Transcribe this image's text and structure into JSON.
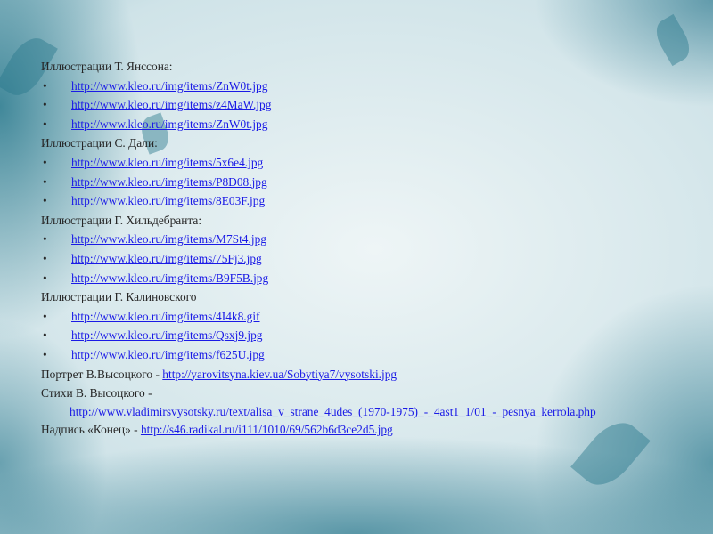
{
  "sections": [
    {
      "heading": "Иллюстрации Т. Янссона:",
      "links": [
        "http://www.kleo.ru/img/items/ZnW0t.jpg",
        "http://www.kleo.ru/img/items/z4MaW.jpg",
        "http://www.kleo.ru/img/items/ZnW0t.jpg"
      ]
    },
    {
      "heading": "Иллюстрации С. Дали:",
      "links": [
        "http://www.kleo.ru/img/items/5x6e4.jpg",
        "http://www.kleo.ru/img/items/P8D08.jpg",
        "http://www.kleo.ru/img/items/8E03F.jpg"
      ]
    },
    {
      "heading": "Иллюстрации  Г. Хильдебранта:",
      "links": [
        "http://www.kleo.ru/img/items/M7St4.jpg",
        "http://www.kleo.ru/img/items/75Fj3.jpg",
        "http://www.kleo.ru/img/items/B9F5B.jpg"
      ]
    },
    {
      "heading": "Иллюстрации  Г. Калиновского",
      "links": [
        "http://www.kleo.ru/img/items/4I4k8.gif",
        "http://www.kleo.ru/img/items/Qsxj9.jpg",
        "http://www.kleo.ru/img/items/f625U.jpg"
      ]
    }
  ],
  "portrait": {
    "label": "Портрет В.Высоцкого - ",
    "link": "http://yarovitsyna.kiev.ua/Sobytiya7/vysotski.jpg"
  },
  "poems": {
    "label": "Стихи В. Высоцкого -",
    "link": "http://www.vladimirsvysotsky.ru/text/alisa_v_strane_4udes_(1970-1975)_-_4ast1_1/01_-_pesnya_kerrola.php"
  },
  "ending": {
    "label": "Надпись «Конец» - ",
    "link": "http://s46.radikal.ru/i111/1010/69/562b6d3ce2d5.jpg"
  },
  "bullet": "•"
}
